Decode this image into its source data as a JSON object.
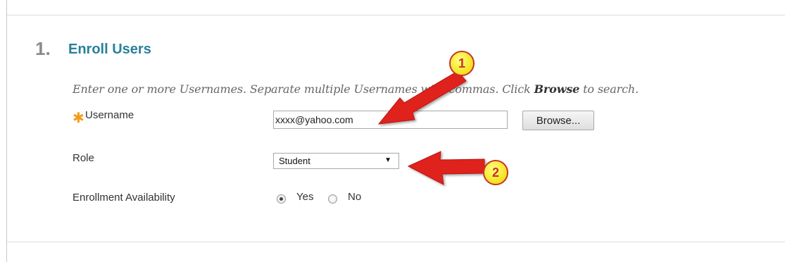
{
  "section": {
    "number": "1.",
    "title": "Enroll Users",
    "instructions": {
      "before": "Enter one or more Usernames. Separate multiple Usernames with commas. Click ",
      "bold": "Browse",
      "after": " to search."
    }
  },
  "form": {
    "required_marker": "✱",
    "username": {
      "label": "Username",
      "value": "xxxx@yahoo.com",
      "browse_label": "Browse..."
    },
    "role": {
      "label": "Role",
      "selected": "Student",
      "arrow": "▼"
    },
    "availability": {
      "label": "Enrollment Availability",
      "options": [
        "Yes",
        "No"
      ],
      "selected": "Yes"
    }
  },
  "annotations": [
    {
      "number": "1"
    },
    {
      "number": "2"
    }
  ],
  "colors": {
    "title": "#2a7f9b",
    "required": "#f39b1a",
    "arrow": "#e0201b",
    "badge": "#f4e21c"
  }
}
